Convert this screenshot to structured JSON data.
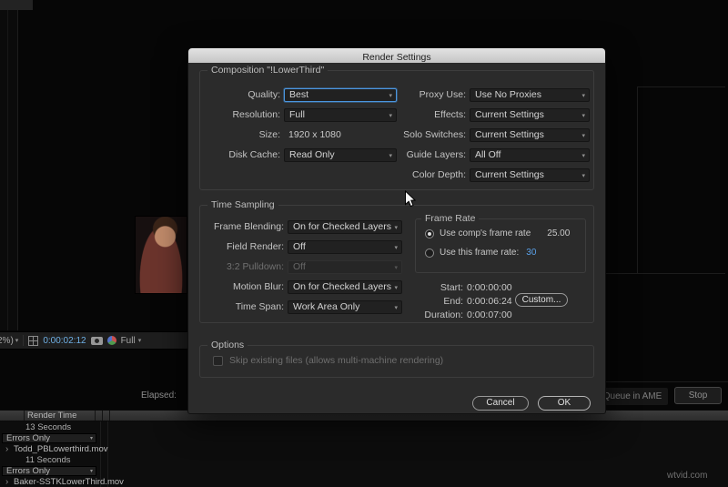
{
  "icons": {
    "chevron_down": "▾",
    "chevron_right": "›"
  },
  "colors": {
    "accent_blue": "#4a96e0",
    "timecode_blue": "#6fb1e6",
    "rate_link_blue": "#5aa0e8"
  },
  "dialog": {
    "title": "Render Settings",
    "composition": {
      "legend": "Composition \"!LowerThird\"",
      "quality": {
        "label": "Quality:",
        "value": "Best"
      },
      "resolution": {
        "label": "Resolution:",
        "value": "Full"
      },
      "size": {
        "label": "Size:",
        "value": "1920 x 1080"
      },
      "disk_cache": {
        "label": "Disk Cache:",
        "value": "Read Only"
      },
      "proxy_use": {
        "label": "Proxy Use:",
        "value": "Use No Proxies"
      },
      "effects": {
        "label": "Effects:",
        "value": "Current Settings"
      },
      "solo_switches": {
        "label": "Solo Switches:",
        "value": "Current Settings"
      },
      "guide_layers": {
        "label": "Guide Layers:",
        "value": "All Off"
      },
      "color_depth": {
        "label": "Color Depth:",
        "value": "Current Settings"
      }
    },
    "time_sampling": {
      "legend": "Time Sampling",
      "frame_blending": {
        "label": "Frame Blending:",
        "value": "On for Checked Layers"
      },
      "field_render": {
        "label": "Field Render:",
        "value": "Off"
      },
      "pulldown": {
        "label": "3:2 Pulldown:",
        "value": "Off"
      },
      "motion_blur": {
        "label": "Motion Blur:",
        "value": "On for Checked Layers"
      },
      "time_span": {
        "label": "Time Span:",
        "value": "Work Area Only"
      },
      "frame_rate": {
        "legend": "Frame Rate",
        "comp_rate_label": "Use comp's frame rate",
        "comp_rate_value": "25.00",
        "custom_rate_label": "Use this frame rate:",
        "custom_rate_value": "30"
      },
      "start": {
        "label": "Start:",
        "value": "0:00:00:00"
      },
      "end": {
        "label": "End:",
        "value": "0:00:06:24"
      },
      "duration": {
        "label": "Duration:",
        "value": "0:00:07:00"
      },
      "custom_button": "Custom..."
    },
    "options": {
      "legend": "Options",
      "skip_label": "Skip existing files (allows multi-machine rendering)"
    },
    "cancel_button": "Cancel",
    "ok_button": "OK"
  },
  "viewer_toolbar": {
    "zoom": "2%)",
    "timecode": "0:00:02:12",
    "resolution": "Full"
  },
  "render_queue": {
    "elapsed_label": "Elapsed:",
    "queue_ame_button": "Queue in AME",
    "stop_button": "Stop",
    "header": "Render Time",
    "items": [
      {
        "render_time": "13 Seconds",
        "log": "Errors Only",
        "output": "Todd_PBLowerthird.mov"
      },
      {
        "render_time": "11 Seconds",
        "log": "Errors Only",
        "output": "Baker-SSTKLowerThird.mov"
      }
    ]
  },
  "watermark": "wtvid.com"
}
